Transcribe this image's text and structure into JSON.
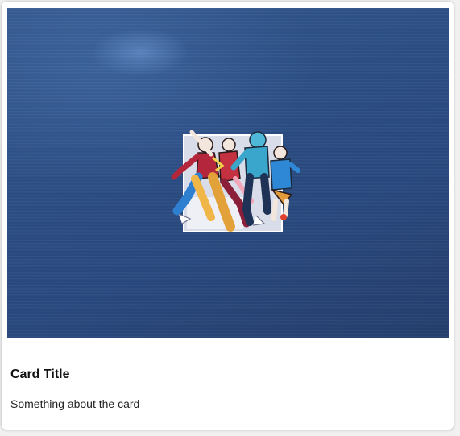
{
  "card": {
    "title": "Card Title",
    "text": "Something about the card"
  },
  "media": {
    "description_icon": "dancing-group-artwork"
  },
  "colors": {
    "card_background": "#ffffff",
    "page_background": "#f1f1f1",
    "media_background": "#2c4f86",
    "title_color": "#111111",
    "text_color": "#222222"
  }
}
